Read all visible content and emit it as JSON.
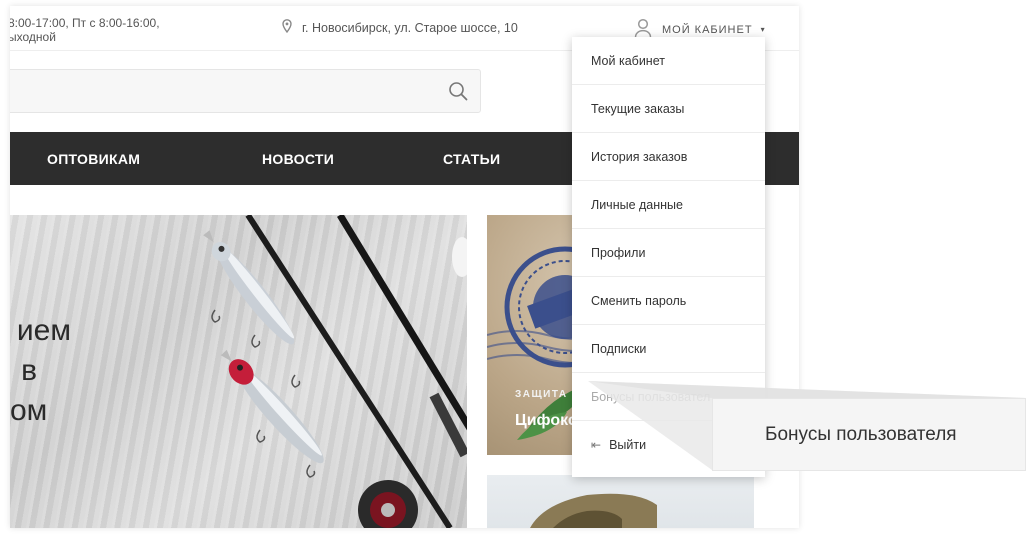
{
  "topbar": {
    "hours_line1": "8:00-17:00, Пт с 8:00-16:00,",
    "hours_line2": "ыходной",
    "address": "г. Новосибирск, ул. Старое шоссе, 10",
    "cabinet_label": "МОЙ КАБИНЕТ",
    "cabinet_caret": "▾"
  },
  "nav": {
    "items": [
      "ОПТОВИКАМ",
      "НОВОСТИ",
      "СТАТЬИ"
    ]
  },
  "banner": {
    "lines": [
      "ием",
      "в",
      "ом"
    ]
  },
  "tile": {
    "caption_small": "ЗАЩИТА О",
    "caption_big": "Цифокс"
  },
  "dropdown": {
    "items": [
      "Мой кабинет",
      "Текущие заказы",
      "История заказов",
      "Личные данные",
      "Профили",
      "Сменить пароль",
      "Подписки",
      "Бонусы пользовател",
      "Выйти"
    ],
    "logout_icon": "⇤"
  },
  "callout": {
    "label": "Бонусы пользователя"
  },
  "colors": {
    "nav_bg": "#2d2d2d",
    "dropdown_bg": "#ffffff",
    "callout_bg": "#f5f5f5"
  }
}
